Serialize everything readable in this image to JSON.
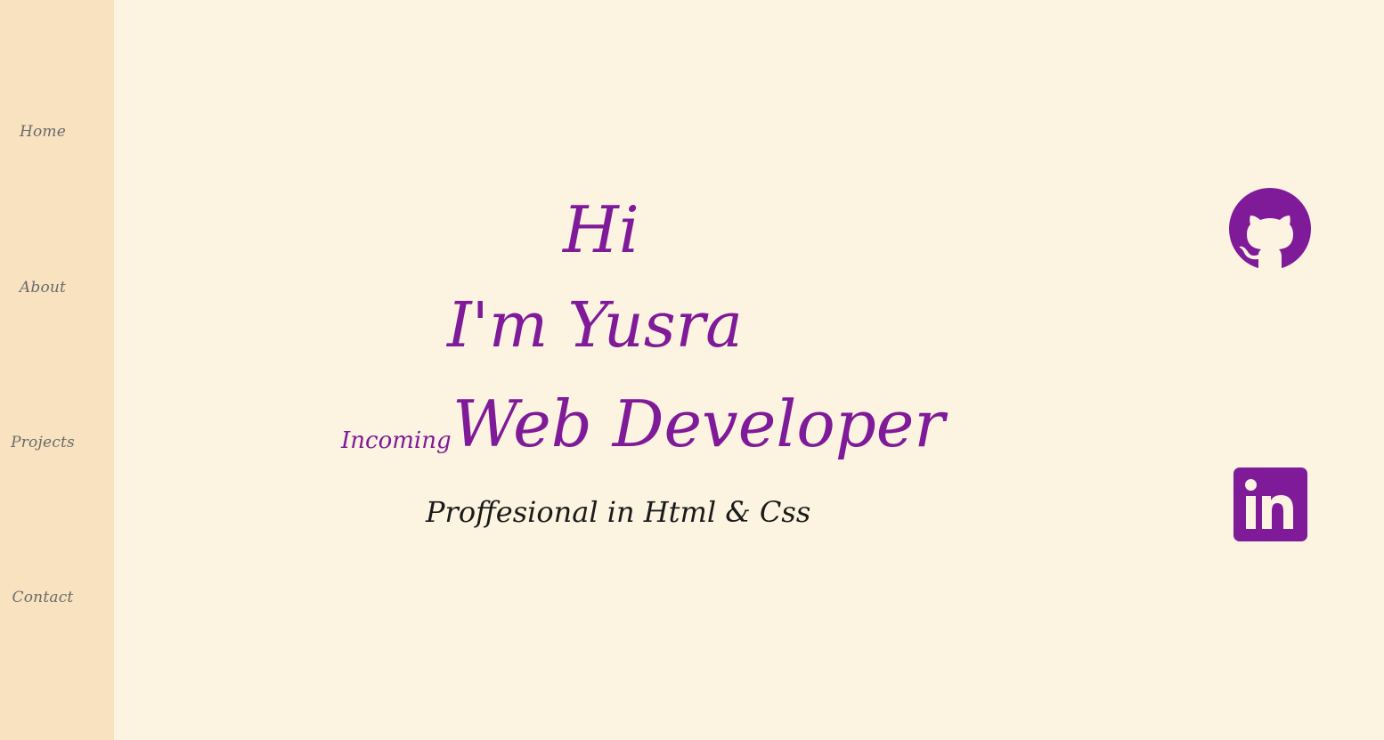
{
  "nav": {
    "home": "Home",
    "about": "About",
    "projects": "Projects",
    "contact": "Contact"
  },
  "hero": {
    "greeting": "Hi",
    "name_line": "I'm Yusra",
    "role_prefix": "Incoming",
    "role": "Web Developer",
    "tagline": "Proffesional in Html & Css"
  },
  "social": {
    "github_icon": "github-icon",
    "linkedin_icon": "linkedin-icon"
  },
  "colors": {
    "background": "#fcf4e1",
    "sidebar": "#f8e2c0",
    "accent": "#7f1a98",
    "nav_text": "#6b6b6b",
    "tagline_text": "#1a1a1a"
  }
}
